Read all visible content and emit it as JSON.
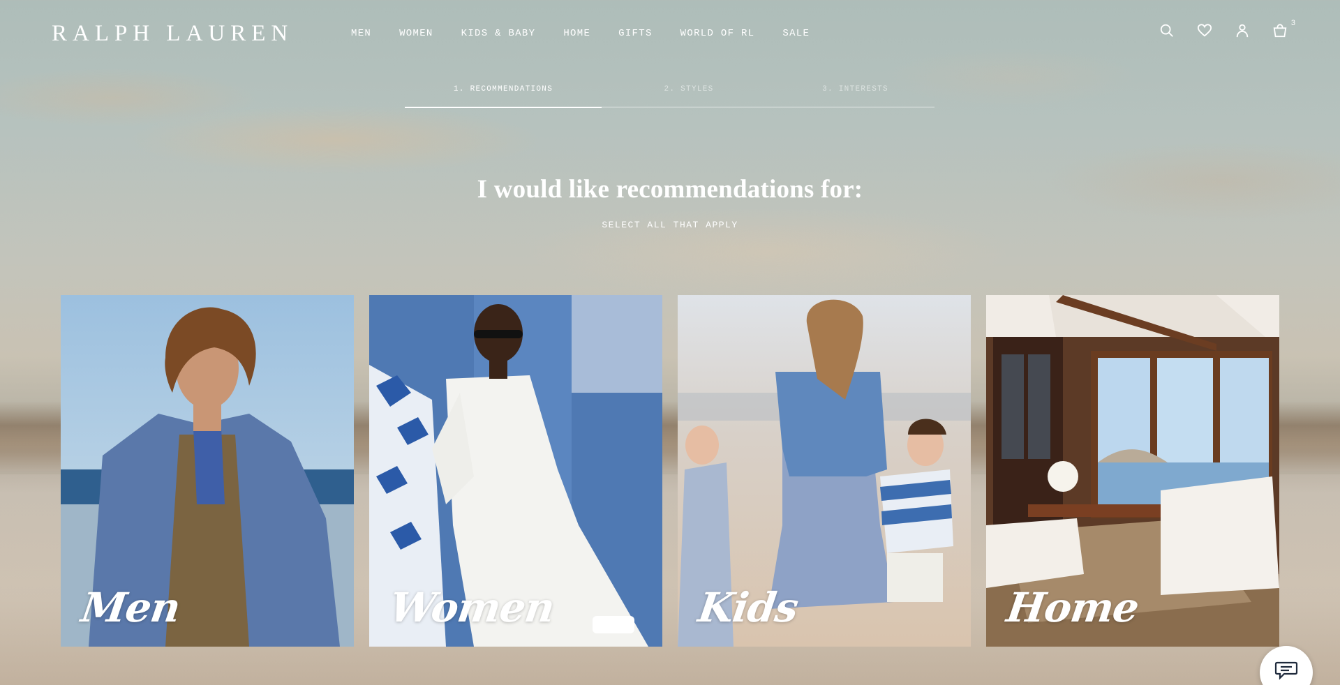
{
  "brand": {
    "logo_text": "RALPH LAUREN"
  },
  "nav": {
    "items": [
      {
        "label": "MEN"
      },
      {
        "label": "WOMEN"
      },
      {
        "label": "KIDS & BABY"
      },
      {
        "label": "HOME"
      },
      {
        "label": "GIFTS"
      },
      {
        "label": "WORLD OF RL"
      },
      {
        "label": "SALE"
      }
    ]
  },
  "utility": {
    "icons": [
      "search-icon",
      "heart-icon",
      "account-icon",
      "bag-icon"
    ],
    "bag_count": "3"
  },
  "steps": [
    {
      "label": "1. RECOMMENDATIONS",
      "active": true
    },
    {
      "label": "2. STYLES",
      "active": false
    },
    {
      "label": "3. INTERESTS",
      "active": false
    }
  ],
  "main": {
    "headline": "I would like recommendations for:",
    "subhead": "SELECT ALL THAT APPLY"
  },
  "cards": [
    {
      "label": "Men"
    },
    {
      "label": "Women"
    },
    {
      "label": "Kids"
    },
    {
      "label": "Home"
    }
  ],
  "chat": {
    "icon": "chat-icon"
  },
  "colors": {
    "text": "#ffffff",
    "chat_icon": "#1f2a3c"
  }
}
